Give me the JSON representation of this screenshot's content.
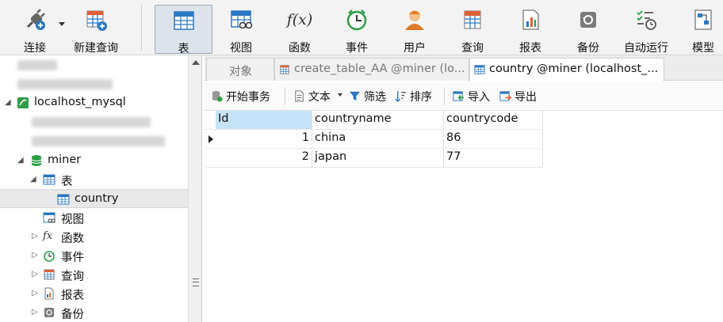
{
  "toolbar": {
    "connect": "连接",
    "new_query": "新建查询",
    "table": "表",
    "view": "视图",
    "function": "函数",
    "event": "事件",
    "user": "用户",
    "query": "查询",
    "report": "报表",
    "backup": "备份",
    "autorun": "自动运行",
    "model": "模型",
    "function_glyph": "f(x)"
  },
  "sidebar": {
    "connection": "localhost_mysql",
    "database": "miner",
    "tables_label": "表",
    "table_item": "country",
    "views_label": "视图",
    "functions_label": "函数",
    "events_label": "事件",
    "queries_label": "查询",
    "reports_label": "报表",
    "backups_label": "备份"
  },
  "tabs": {
    "objects": "对象",
    "tab1": "create_table_AA @miner (lo...",
    "tab2": "country @miner (localhost_..."
  },
  "objbar": {
    "begin_transaction": "开始事务",
    "text": "文本",
    "filter": "筛选",
    "sort": "排序",
    "import": "导入",
    "export": "导出"
  },
  "grid": {
    "columns": [
      "Id",
      "countryname",
      "countrycode"
    ],
    "rows": [
      {
        "id": "1",
        "name": "china",
        "code": "86"
      },
      {
        "id": "2",
        "name": "japan",
        "code": "77"
      }
    ]
  },
  "colors": {
    "selected_header": "#c5e3f6",
    "toolbar_bg": "#f3f3f3",
    "accent_green": "#2e9e46",
    "accent_blue": "#2b78c2"
  }
}
